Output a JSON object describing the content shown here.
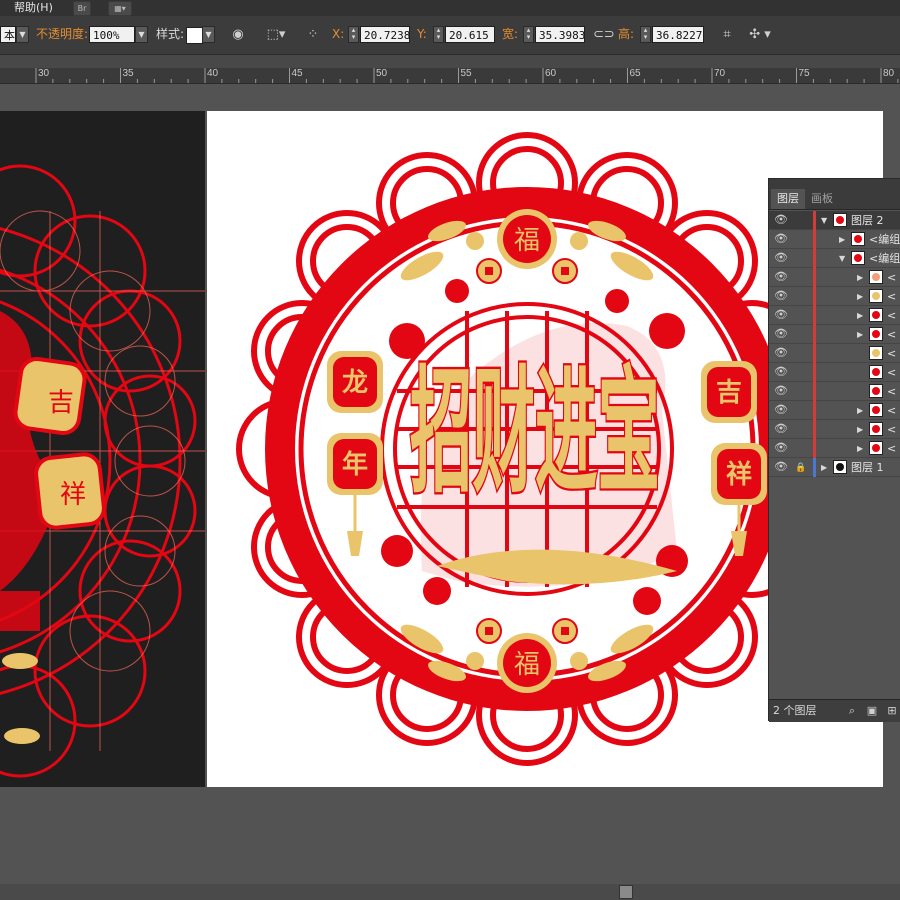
{
  "menubar": {
    "help_label": "帮助(H)",
    "br_label": "Br"
  },
  "controlbar": {
    "style_value": "本",
    "opacity_label": "不透明度:",
    "opacity_value": "100%",
    "style_label": "样式:",
    "x_label": "X:",
    "x_value": "20.7238",
    "y_label": "Y:",
    "y_value": "20.615 c",
    "width_label": "宽:",
    "width_value": "35.3983",
    "height_label": "高:",
    "height_value": "36.8227"
  },
  "ruler": {
    "ticks": [
      "30",
      "35",
      "40",
      "45",
      "50",
      "55",
      "60",
      "65",
      "70",
      "75",
      "80"
    ]
  },
  "artwork": {
    "top_medallion": "福",
    "bottom_medallion": "福",
    "left_tag_top": "龙",
    "left_tag_bottom": "年",
    "right_tag_top": "吉",
    "right_tag_bottom": "祥",
    "center_text": "招财进宝",
    "left_preview_text_1": "吉",
    "left_preview_text_2": "祥",
    "colors": {
      "red": "#e30613",
      "gold": "#e9c46a",
      "dark_bg": "#1f1f1f"
    }
  },
  "layers_panel": {
    "tabs": [
      "图层",
      "画板"
    ],
    "rows": [
      {
        "name": "图层 2",
        "expanded": true,
        "indent": 0
      },
      {
        "name": "<编组",
        "expanded": false,
        "indent": 1
      },
      {
        "name": "<编组",
        "expanded": true,
        "indent": 1
      },
      {
        "name": "<",
        "expanded": false,
        "indent": 2
      },
      {
        "name": "<",
        "expanded": false,
        "indent": 2
      },
      {
        "name": "<",
        "expanded": false,
        "indent": 2
      },
      {
        "name": "<",
        "expanded": false,
        "indent": 2
      },
      {
        "name": "<",
        "expanded": null,
        "indent": 2
      },
      {
        "name": "<",
        "expanded": null,
        "indent": 2
      },
      {
        "name": "<",
        "expanded": null,
        "indent": 2
      },
      {
        "name": "<",
        "expanded": false,
        "indent": 2
      },
      {
        "name": "<",
        "expanded": false,
        "indent": 2
      },
      {
        "name": "<",
        "expanded": false,
        "indent": 2
      },
      {
        "name": "图层 1",
        "expanded": false,
        "indent": 0
      }
    ],
    "footer_count": "2 个图层"
  }
}
